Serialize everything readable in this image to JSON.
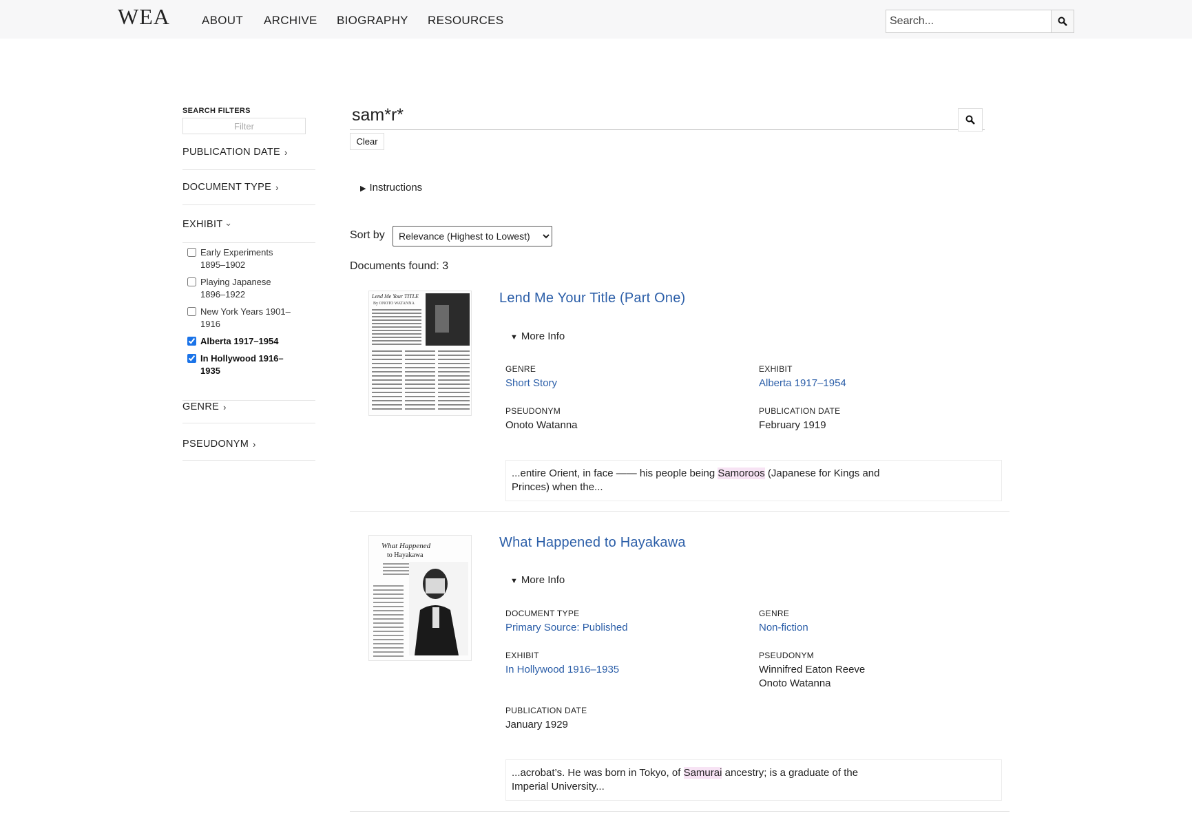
{
  "nav": {
    "logo": "WEA",
    "links": [
      "ABOUT",
      "ARCHIVE",
      "BIOGRAPHY",
      "RESOURCES"
    ],
    "search_placeholder": "Search..."
  },
  "sidebar": {
    "heading": "SEARCH FILTERS",
    "filter_placeholder": "Filter",
    "facets": {
      "publication_date": "PUBLICATION DATE",
      "document_type": "DOCUMENT TYPE",
      "exhibit": "EXHIBIT",
      "genre": "GENRE",
      "pseudonym": "PSEUDONYM"
    },
    "exhibit_items": [
      {
        "label": "Early Experiments 1895–1902",
        "checked": false
      },
      {
        "label": "Playing Japanese 1896–1922",
        "checked": false
      },
      {
        "label": "New York Years 1901–1916",
        "checked": false
      },
      {
        "label": "Alberta 1917–1954",
        "checked": true
      },
      {
        "label": "In Hollywood 1916–1935",
        "checked": true
      }
    ]
  },
  "main": {
    "query": "sam*r*",
    "clear_label": "Clear",
    "instructions_label": "Instructions",
    "sort_label": "Sort by",
    "sort_value": "Relevance (Highest to Lowest)",
    "found_text": "Documents found: 3",
    "more_info_label": "More Info",
    "results": [
      {
        "title": "Lend Me Your Title (Part One)",
        "fields": {
          "genre_label": "GENRE",
          "genre": "Short Story",
          "exhibit_label": "EXHIBIT",
          "exhibit": "Alberta 1917–1954",
          "pseudonym_label": "PSEUDONYM",
          "pseudonym": "Onoto Watanna",
          "date_label": "PUBLICATION DATE",
          "date": "February 1919"
        },
        "snippet": {
          "before": "...entire Orient, in face —— his people being ",
          "highlight": "Samoroos",
          "after": " (Japanese for Kings and Princes) when the..."
        }
      },
      {
        "title": "What Happened to Hayakawa",
        "fields": {
          "doctype_label": "DOCUMENT TYPE",
          "doctype": "Primary Source: Published",
          "genre_label": "GENRE",
          "genre": "Non-fiction",
          "exhibit_label": "EXHIBIT",
          "exhibit": "In Hollywood 1916–1935",
          "pseudonym_label": "PSEUDONYM",
          "pseudonym_1": "Winnifred Eaton Reeve",
          "pseudonym_2": "Onoto Watanna",
          "date_label": "PUBLICATION DATE",
          "date": "January 1929"
        },
        "snippet": {
          "before": "...acrobat’s. He was born in Tokyo, of ",
          "highlight": "Samurai",
          "after": " ancestry; is a graduate of the Imperial University..."
        }
      }
    ]
  }
}
